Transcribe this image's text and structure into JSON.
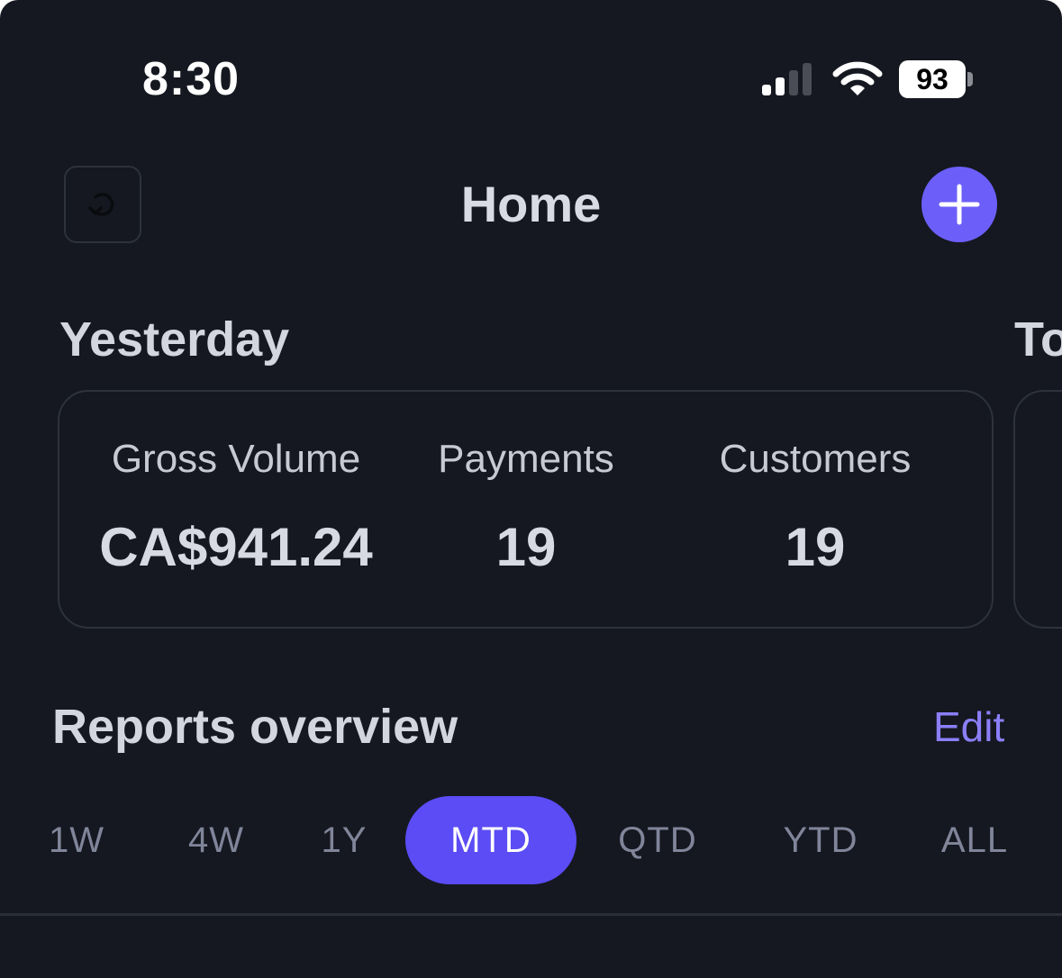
{
  "status_bar": {
    "time": "8:30",
    "battery": "93",
    "icons": [
      "signal-icon",
      "wifi-icon",
      "battery-icon"
    ]
  },
  "nav": {
    "title": "Home",
    "left_icon": "history-icon",
    "right_icon": "plus-icon"
  },
  "colors": {
    "background": "#151820",
    "accent": "#5b4cf5",
    "accent_light": "#8b7ff8",
    "card_border": "#2e323c"
  },
  "summary": {
    "yesterday": {
      "heading": "Yesterday",
      "metrics": [
        {
          "label": "Gross Volume",
          "value": "CA$941.24"
        },
        {
          "label": "Payments",
          "value": "19"
        },
        {
          "label": "Customers",
          "value": "19"
        }
      ]
    },
    "next_heading_partial": "To"
  },
  "reports": {
    "heading": "Reports overview",
    "edit_label": "Edit",
    "periods": [
      "1W",
      "4W",
      "1Y",
      "MTD",
      "QTD",
      "YTD",
      "ALL"
    ],
    "selected_period": "MTD"
  }
}
